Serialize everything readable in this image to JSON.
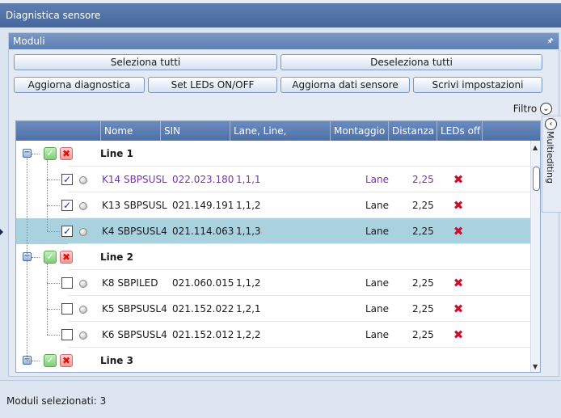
{
  "window": {
    "title": "Diagnistica sensore"
  },
  "panel": {
    "title": "Moduli",
    "pin_icon": "pin-icon"
  },
  "buttons": {
    "select_all": "Seleziona tutti",
    "deselect_all": "Deseleziona tutti",
    "update_diag": "Aggiorna diagnostica",
    "set_leds": "Set LEDs ON/OFF",
    "update_sensor": "Aggiorna dati sensore",
    "write_settings": "Scrivi impostazioni"
  },
  "filter": {
    "label": "Filtro",
    "icon": "chevron-down-icon"
  },
  "sidetab": {
    "label": "Multiediting",
    "icon": "chevron-left-icon"
  },
  "columns": [
    "Nome",
    "SIN",
    "Lane, Line, Posizione",
    "Montaggio",
    "Distanza",
    "LEDs off"
  ],
  "rows": [
    {
      "type": "group",
      "name": "Line 1"
    },
    {
      "type": "item",
      "checked": true,
      "name": "K14 SBPSUSL",
      "sin": "022.023.180",
      "pos": "1,1,1",
      "mount": "Lane",
      "dist": "2,25",
      "leds_off": true,
      "highlight": "purple"
    },
    {
      "type": "item",
      "checked": true,
      "name": "K13 SBPSUSL",
      "sin": "021.149.191",
      "pos": "1,1,2",
      "mount": "Lane",
      "dist": "2,25",
      "leds_off": true
    },
    {
      "type": "item",
      "checked": true,
      "name": "K4 SBPSUSL4",
      "sin": "021.114.063",
      "pos": "1,1,3",
      "mount": "Lane",
      "dist": "2,25",
      "leds_off": true,
      "selected": true
    },
    {
      "type": "group",
      "name": "Line 2"
    },
    {
      "type": "item",
      "checked": false,
      "name": "K8 SBPILED",
      "sin": "021.060.015",
      "pos": "1,1,2",
      "mount": "Lane",
      "dist": "2,25",
      "leds_off": true
    },
    {
      "type": "item",
      "checked": false,
      "name": "K5 SBPSUSL4",
      "sin": "021.152.022",
      "pos": "1,2,1",
      "mount": "Lane",
      "dist": "2,25",
      "leds_off": true
    },
    {
      "type": "item",
      "checked": false,
      "name": "K6 SBPSUSL4",
      "sin": "021.152.012",
      "pos": "1,2,2",
      "mount": "Lane",
      "dist": "2,25",
      "leds_off": true
    },
    {
      "type": "group",
      "name": "Line 3"
    }
  ],
  "status": {
    "text": "Moduli selezionati: 3"
  },
  "colors": {
    "header": "#4d70a8",
    "selected_row": "#a9d2de",
    "accent_purple": "#7b2fb0",
    "x_red": "#c8102e"
  }
}
